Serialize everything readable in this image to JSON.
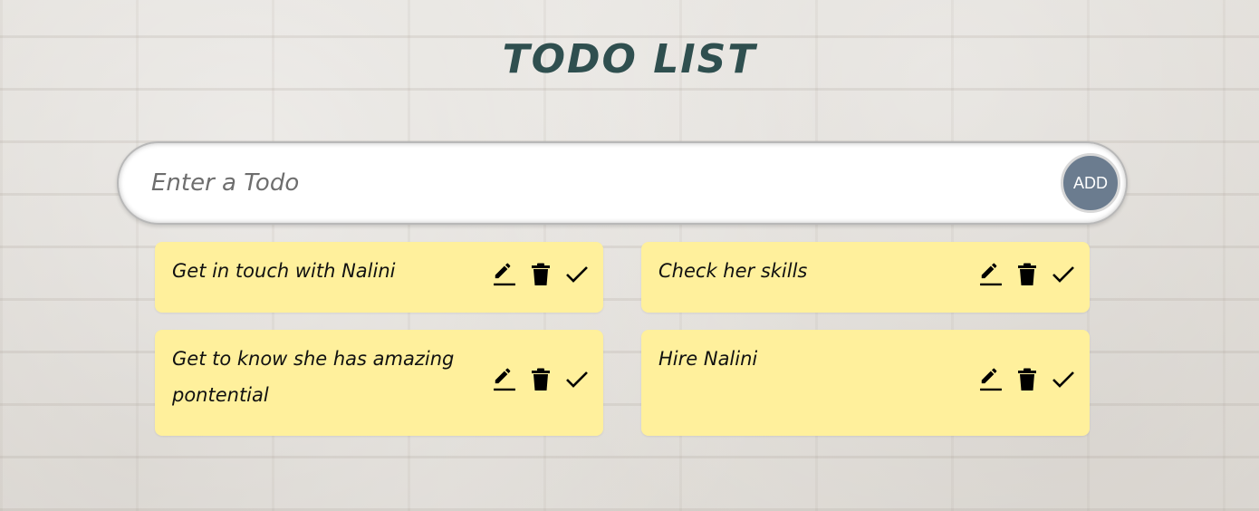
{
  "header": {
    "title": "TODO LIST"
  },
  "input": {
    "placeholder": "Enter a Todo",
    "value": "",
    "add_label": "ADD"
  },
  "todos": [
    {
      "text": "Get in touch with Nalini"
    },
    {
      "text": "Check her skills"
    },
    {
      "text": "Get to know she has amazing pontential"
    },
    {
      "text": "Hire Nalini"
    }
  ],
  "icons": {
    "edit": "pencil-icon",
    "delete": "trash-icon",
    "complete": "check-icon"
  },
  "colors": {
    "title": "#2f4f4f",
    "card": "#fff09c",
    "add_button": "#6b7c8f",
    "icon": "#000000"
  }
}
